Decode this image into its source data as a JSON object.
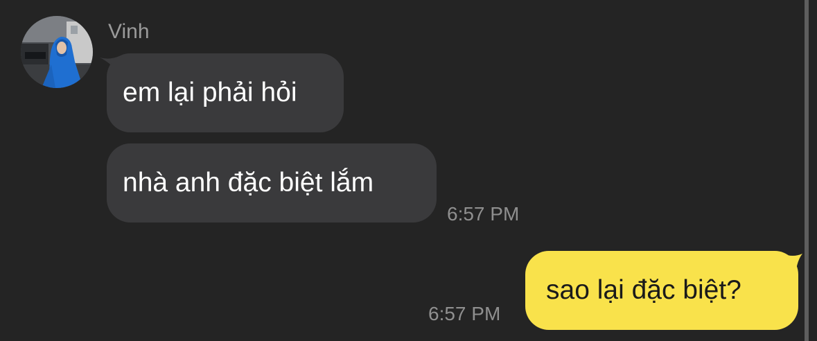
{
  "chat": {
    "sender_name": "Vinh",
    "messages": [
      {
        "direction": "incoming",
        "text": "em lại phải hỏi"
      },
      {
        "direction": "incoming",
        "text": "nhà anh đặc biệt lắm",
        "time": "6:57 PM"
      },
      {
        "direction": "outgoing",
        "text": "sao lại đặc biệt?",
        "time": "6:57 PM"
      }
    ]
  },
  "colors": {
    "background": "#242424",
    "incoming_bubble": "#3a3a3c",
    "outgoing_bubble": "#f9e24b",
    "timestamp": "#8f8f8f"
  }
}
